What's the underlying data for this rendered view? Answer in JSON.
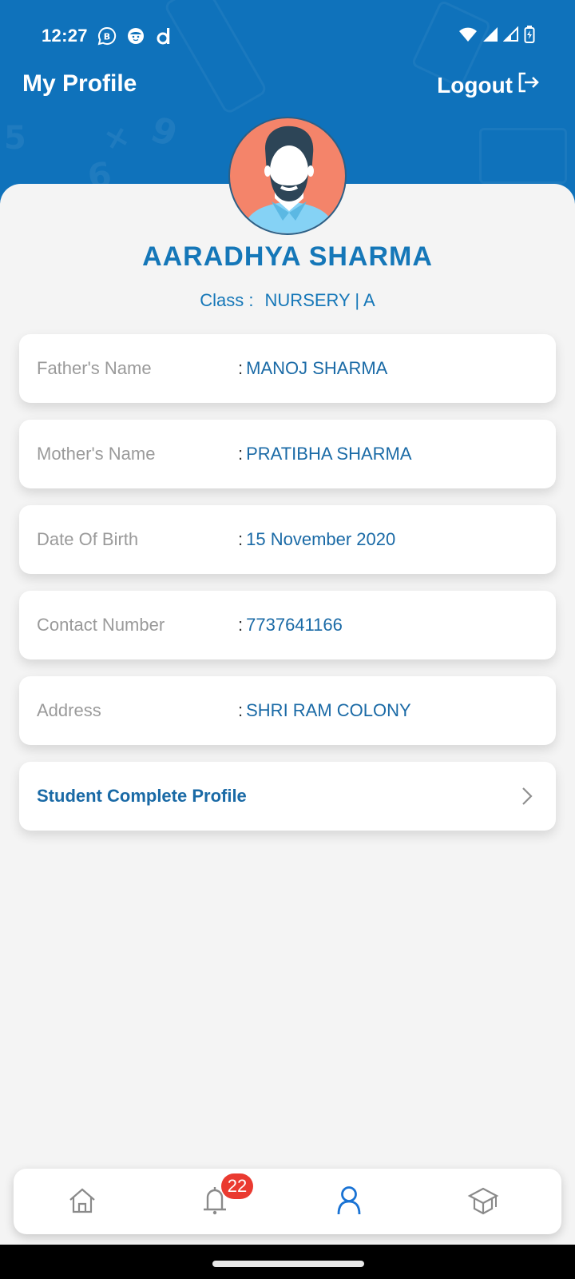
{
  "status_bar": {
    "time": "12:27",
    "app_icons": [
      "whatsapp-business-icon",
      "kids-face-icon",
      "dailyhunt-d-icon"
    ],
    "system_icons": [
      "wifi-icon",
      "signal-full-icon",
      "signal-partial-icon",
      "battery-charging-icon"
    ]
  },
  "header": {
    "title": "My Profile",
    "logout_label": "Logout",
    "logout_icon": "logout-icon",
    "background_color": "#0f72bb"
  },
  "profile": {
    "avatar_icon": "male-avatar-icon",
    "name": "AARADHYA SHARMA",
    "class_label": "Class :",
    "class_value": "NURSERY | A",
    "accent_color": "#1577b8"
  },
  "details": [
    {
      "label": "Father's Name",
      "value": "MANOJ SHARMA"
    },
    {
      "label": "Mother's Name",
      "value": "PRATIBHA SHARMA"
    },
    {
      "label": "Date Of Birth",
      "value": "15 November 2020"
    },
    {
      "label": "Contact Number",
      "value": "7737641166"
    },
    {
      "label": "Address",
      "value": "SHRI RAM COLONY"
    }
  ],
  "separator": ":",
  "complete_profile": {
    "label": "Student Complete Profile",
    "icon": "chevron-right-icon"
  },
  "bottom_nav": {
    "items": [
      {
        "name": "home",
        "icon": "home-icon",
        "active": false
      },
      {
        "name": "notifications",
        "icon": "bell-icon",
        "active": false,
        "badge": "22"
      },
      {
        "name": "profile",
        "icon": "user-icon",
        "active": true
      },
      {
        "name": "academics",
        "icon": "graduation-cap-icon",
        "active": false
      }
    ],
    "active_color": "#1a73d4",
    "inactive_color": "#8a8a8a",
    "badge_color": "#ea3a30"
  }
}
